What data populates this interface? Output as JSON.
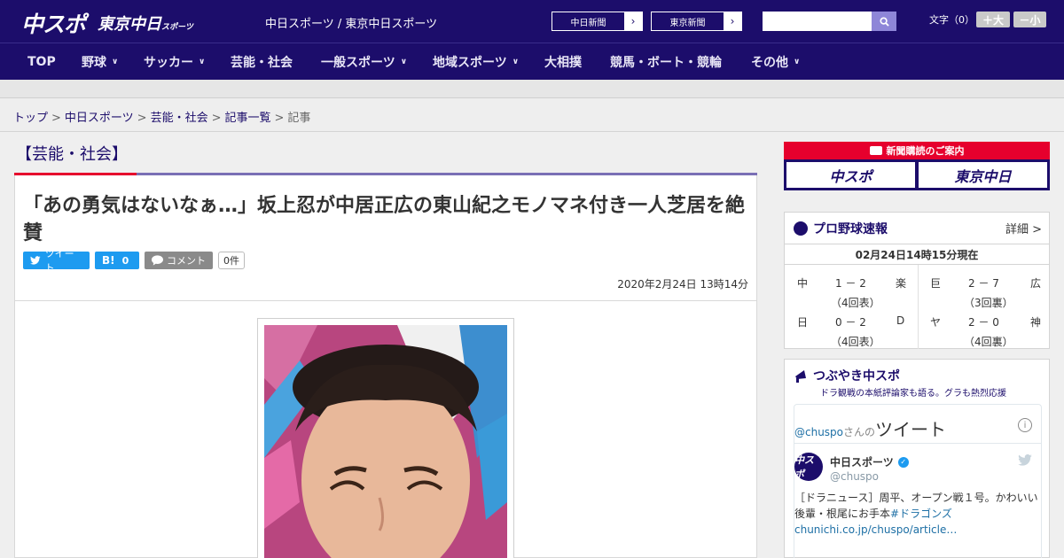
{
  "header": {
    "logo_chuspo": "中スポ",
    "logo_tokyo": "東京中日",
    "logo_tokyo_small": "スポーツ",
    "site_names": "中日スポーツ / 東京中日スポーツ",
    "ext_links": [
      "中日新聞",
      "東京新聞"
    ],
    "search": {
      "placeholder": ""
    },
    "font_label": "文字（0）",
    "font_plus": "＋大",
    "font_minus": "－小"
  },
  "nav": {
    "items": [
      {
        "label": "TOP",
        "has_menu": false
      },
      {
        "label": "野球",
        "has_menu": true
      },
      {
        "label": "サッカー",
        "has_menu": true
      },
      {
        "label": "芸能・社会",
        "has_menu": false
      },
      {
        "label": "一般スポーツ",
        "has_menu": true
      },
      {
        "label": "地域スポーツ",
        "has_menu": true
      },
      {
        "label": "大相撲",
        "has_menu": false
      },
      {
        "label": "競馬・ボート・競輪",
        "has_menu": false
      },
      {
        "label": "その他",
        "has_menu": true
      }
    ]
  },
  "breadcrumb": {
    "items": [
      "トップ",
      "中日スポーツ",
      "芸能・社会",
      "記事一覧"
    ],
    "current": "記事",
    "separator": ">"
  },
  "article": {
    "category": "【芸能・社会】",
    "headline": "「あの勇気はないなぁ…」坂上忍が中居正広の東山紀之モノマネ付き一人芝居を絶賛",
    "share": {
      "tweet": "ツイート",
      "hatena_label": "B!",
      "hatena_count": "0",
      "comment": "コメント",
      "comment_count": "0件"
    },
    "date": "2020年2月24日 13時14分"
  },
  "sidebar": {
    "subscription": {
      "title": "新聞購読のご案内",
      "chuspo": "中スポ",
      "tokyo": "東京中日"
    },
    "scores": {
      "title": "プロ野球速報",
      "detail": "詳細 >",
      "time": "02月24日14時15分現在",
      "games": [
        {
          "home": "中",
          "score": "1 － 2",
          "away": "楽",
          "inning": "（4回表）"
        },
        {
          "home": "巨",
          "score": "2 － 7",
          "away": "広",
          "inning": "（3回裏）"
        },
        {
          "home": "日",
          "score": "0 － 2",
          "away": "D",
          "inning": "（4回表）"
        },
        {
          "home": "ヤ",
          "score": "2 － 0",
          "away": "神",
          "inning": "（4回裏）"
        }
      ]
    },
    "tweets": {
      "title": "つぶやき中スポ",
      "subtitle": "ドラ観戦の本紙評論家も語る。グラも熱烈応援",
      "handle_prefix": "@chuspo",
      "handle_suffix": "さんの",
      "tweets_word": "ツイート",
      "account_name": "中日スポーツ",
      "account_handle": "@chuspo",
      "text": "［ドラニュース］周平、オープン戦１号。かわいい後輩・根尾にお手本",
      "hashtag": "#ドラゴンズ",
      "link": "chunichi.co.jp/chuspo/article…"
    }
  },
  "colors": {
    "brand": "#1c0d6b",
    "accent_red": "#e6002d",
    "accent_purple": "#7a6fb5",
    "twitter": "#1d9bf0"
  }
}
